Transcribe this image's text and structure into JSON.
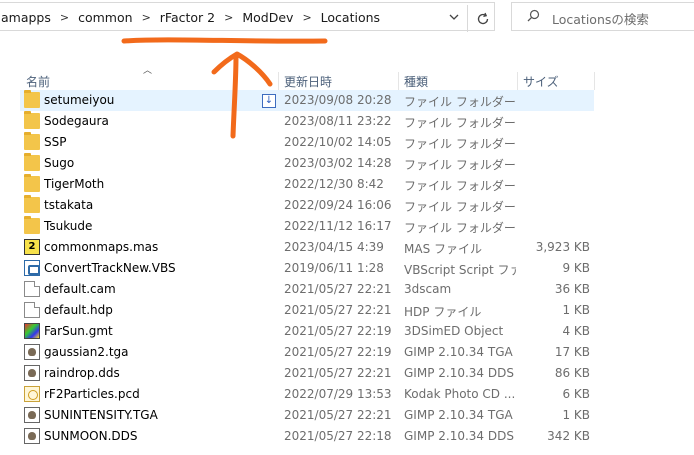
{
  "address": {
    "crumbs": [
      "amapps",
      "common",
      "rFactor 2",
      "ModDev",
      "Locations"
    ],
    "separator": ">"
  },
  "search": {
    "placeholder": "Locationsの検索"
  },
  "columns": {
    "name": "名前",
    "date": "更新日時",
    "type": "種類",
    "size": "サイズ"
  },
  "files": [
    {
      "name": "setumeiyou",
      "date": "2023/09/08 20:28",
      "type": "ファイル フォルダー",
      "size": "",
      "icon": "folder-icon"
    },
    {
      "name": "Sodegaura",
      "date": "2023/08/11 23:22",
      "type": "ファイル フォルダー",
      "size": "",
      "icon": "folder-icon"
    },
    {
      "name": "SSP",
      "date": "2022/10/02 14:05",
      "type": "ファイル フォルダー",
      "size": "",
      "icon": "folder-icon"
    },
    {
      "name": "Sugo",
      "date": "2023/03/02 14:28",
      "type": "ファイル フォルダー",
      "size": "",
      "icon": "folder-icon"
    },
    {
      "name": "TigerMoth",
      "date": "2022/12/30 8:42",
      "type": "ファイル フォルダー",
      "size": "",
      "icon": "folder-icon"
    },
    {
      "name": "tstakata",
      "date": "2022/09/24 16:06",
      "type": "ファイル フォルダー",
      "size": "",
      "icon": "folder-icon"
    },
    {
      "name": "Tsukude",
      "date": "2022/11/12 16:17",
      "type": "ファイル フォルダー",
      "size": "",
      "icon": "folder-icon"
    },
    {
      "name": "commonmaps.mas",
      "date": "2023/04/15 4:39",
      "type": "MAS ファイル",
      "size": "3,923 KB",
      "icon": "mas-file-icon"
    },
    {
      "name": "ConvertTrackNew.VBS",
      "date": "2019/06/11 1:28",
      "type": "VBScript Script ファ...",
      "size": "9 KB",
      "icon": "vbs-file-icon"
    },
    {
      "name": "default.cam",
      "date": "2021/05/27 22:21",
      "type": "3dscam",
      "size": "36 KB",
      "icon": "file-icon"
    },
    {
      "name": "default.hdp",
      "date": "2021/05/27 22:21",
      "type": "HDP ファイル",
      "size": "1 KB",
      "icon": "file-icon"
    },
    {
      "name": "FarSun.gmt",
      "date": "2021/05/27 22:19",
      "type": "3DSimED Object",
      "size": "4 KB",
      "icon": "gmt-file-icon"
    },
    {
      "name": "gaussian2.tga",
      "date": "2021/05/27 22:19",
      "type": "GIMP 2.10.34 TGA",
      "size": "17 KB",
      "icon": "gimp-file-icon"
    },
    {
      "name": "raindrop.dds",
      "date": "2021/05/27 22:21",
      "type": "GIMP 2.10.34 DDS",
      "size": "86 KB",
      "icon": "gimp-file-icon"
    },
    {
      "name": "rF2Particles.pcd",
      "date": "2022/07/29 13:53",
      "type": "Kodak Photo CD ...",
      "size": "6 KB",
      "icon": "pcd-file-icon"
    },
    {
      "name": "SUNINTENSITY.TGA",
      "date": "2021/05/27 22:21",
      "type": "GIMP 2.10.34 TGA",
      "size": "1 KB",
      "icon": "gimp-file-icon"
    },
    {
      "name": "SUNMOON.DDS",
      "date": "2021/05/27 22:18",
      "type": "GIMP 2.10.34 DDS",
      "size": "342 KB",
      "icon": "gimp-file-icon"
    }
  ],
  "colors": {
    "annotation": "#f26a1b",
    "selection": "#e5f3ff"
  }
}
